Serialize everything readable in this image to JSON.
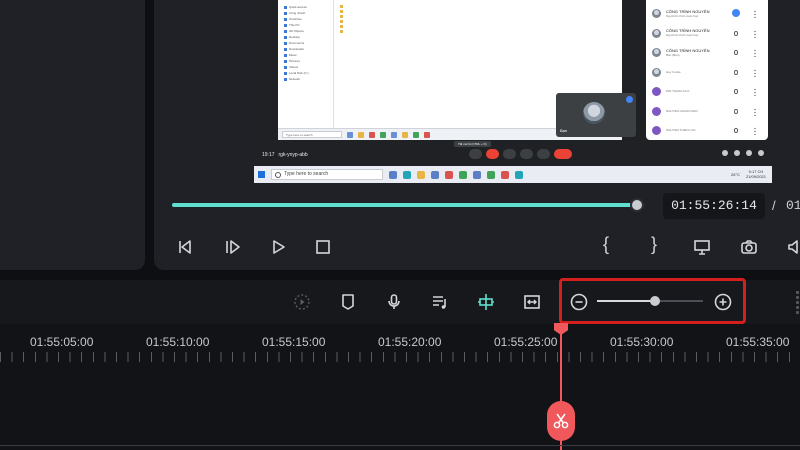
{
  "preview": {
    "explorer_sidebar": [
      "Quick access",
      "Công nhanh",
      "OneDrive",
      "This PC",
      "3D Objects",
      "Desktop",
      "Documents",
      "Downloads",
      "Music",
      "Pictures",
      "Videos",
      "Local Disk (C:)",
      "Network"
    ],
    "explorer_search": "Type here to search",
    "meet_time": "19:17",
    "meet_code": "rgk-ynyp-abb",
    "meet_tooltip": "Tắt micrô (CTRL + D)",
    "self_view_name": "Bạn",
    "participants": [
      {
        "name": "CÔNG TRÌNH NGUYÊN",
        "sub": "Người tổ chức cuộc họp",
        "avatar": "photo"
      },
      {
        "name": "CÔNG TRÌNH NGUYÊN",
        "sub": "Người tổ chức cuộc họp",
        "avatar": "photo"
      },
      {
        "name": "CÔNG TRÌNH NGUYÊN",
        "sub": "Bạn (Bạn)",
        "avatar": "photo"
      },
      {
        "name": "Huy Coolie",
        "sub": "",
        "avatar": "photo"
      },
      {
        "name": "MAI THANH HUY",
        "sub": "",
        "avatar": "purple"
      },
      {
        "name": "NGUYEN HOANG BAO",
        "sub": "",
        "avatar": "purple"
      },
      {
        "name": "NGUYEN THIEN LOC",
        "sub": "",
        "avatar": "purple"
      }
    ],
    "host_search": "Type here to search",
    "host_temp": "26°C",
    "host_clock_time": "9:17 CH",
    "host_clock_date": "21/09/2021"
  },
  "player": {
    "current_time": "01:55:26:14",
    "separator": "/",
    "total_time": "01",
    "progress": 0.985,
    "brace_open": "{",
    "brace_close": "}"
  },
  "timeline": {
    "zoom_level": 0.55,
    "ruler_labels": [
      "01:55:05:00",
      "01:55:10:00",
      "01:55:15:00",
      "01:55:20:00",
      "01:55:25:00",
      "01:55:30:00",
      "01:55:35:00"
    ]
  },
  "colors": {
    "accent_teal": "#5fe0cf",
    "playhead": "#f0585c",
    "highlight_box": "#d41f1f"
  }
}
